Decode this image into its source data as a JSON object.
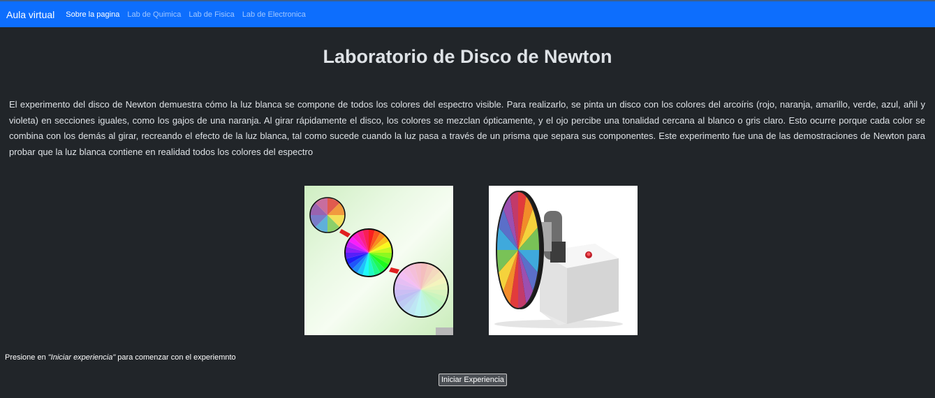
{
  "nav": {
    "brand": "Aula virtual",
    "links": [
      {
        "label": "Sobre la pagina",
        "active": true
      },
      {
        "label": "Lab de Quimica",
        "active": false
      },
      {
        "label": "Lab de Fisica",
        "active": false
      },
      {
        "label": "Lab de Electronica",
        "active": false
      }
    ]
  },
  "main": {
    "title": "Laboratorio de Disco de Newton",
    "description": "El experimento del disco de Newton demuestra cómo la luz blanca se compone de todos los colores del espectro visible. Para realizarlo, se pinta un disco con los colores del arcoíris (rojo, naranja, amarillo, verde, azul, añil y violeta) en secciones iguales, como los gajos de una naranja. Al girar rápidamente el disco, los colores se mezclan ópticamente, y el ojo percibe una tonalidad cercana al blanco o gris claro. Esto ocurre porque cada color se combina con los demás al girar, recreando el efecto de la luz blanca, tal como sucede cuando la luz pasa a través de un prisma que separa sus componentes. Este experimento fue una de las demostraciones de Newton para probar que la luz blanca contiene en realidad todos los colores del espectro",
    "caption": {
      "before": "Presione en ",
      "emphasis": "\"Iniciar experiencia\"",
      "after": " para comenzar con el experiemnto"
    },
    "start_button": "Iniciar Experiencia"
  },
  "images": [
    {
      "name": "newton-disc-diagram",
      "icon": "color-wheel-diagram"
    },
    {
      "name": "newton-disc-device",
      "icon": "spinning-disc-device"
    }
  ],
  "colors": {
    "navbar": "#0d6efd",
    "background": "#212529",
    "text": "#dee2e6"
  }
}
